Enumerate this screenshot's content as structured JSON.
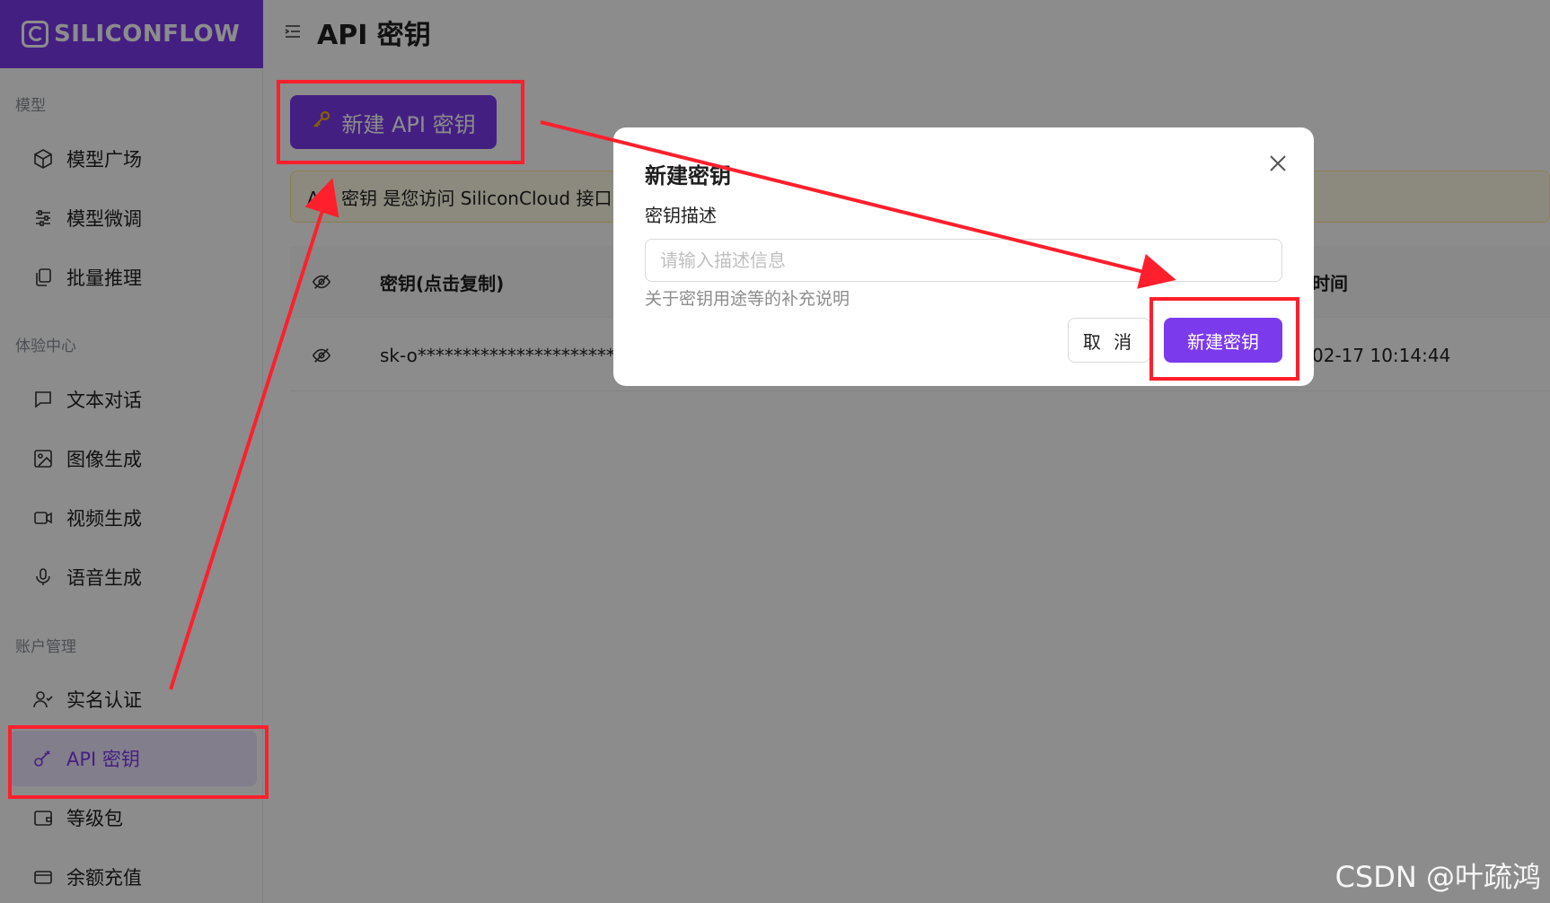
{
  "brand": {
    "name": "SILICONFLOW",
    "accent": "#7c3aed"
  },
  "sidebar": {
    "sections": [
      {
        "label": "模型",
        "items": [
          {
            "label": "模型广场",
            "icon": "cube-icon"
          },
          {
            "label": "模型微调",
            "icon": "sliders-icon"
          },
          {
            "label": "批量推理",
            "icon": "copy-icon"
          }
        ]
      },
      {
        "label": "体验中心",
        "items": [
          {
            "label": "文本对话",
            "icon": "chat-icon"
          },
          {
            "label": "图像生成",
            "icon": "image-icon"
          },
          {
            "label": "视频生成",
            "icon": "video-icon"
          },
          {
            "label": "语音生成",
            "icon": "mic-icon"
          }
        ]
      },
      {
        "label": "账户管理",
        "items": [
          {
            "label": "实名认证",
            "icon": "user-check-icon"
          },
          {
            "label": "API 密钥",
            "icon": "key-icon",
            "active": true
          },
          {
            "label": "等级包",
            "icon": "wallet-icon"
          },
          {
            "label": "余额充值",
            "icon": "card-icon"
          }
        ]
      }
    ]
  },
  "header": {
    "title": "API 密钥"
  },
  "main": {
    "new_key_button": "新建 API 密钥",
    "notice": "API 密钥 是您访问 SiliconCloud 接口的",
    "table": {
      "columns": [
        "密钥(点击复制)",
        "时间"
      ],
      "rows": [
        {
          "key": "sk-o*************************",
          "time": "02-17 10:14:44"
        }
      ]
    }
  },
  "modal": {
    "title": "新建密钥",
    "field_label": "密钥描述",
    "placeholder": "请输入描述信息",
    "value": "",
    "help": "关于密钥用途等的补充说明",
    "cancel": "取 消",
    "submit": "新建密钥"
  },
  "annotation_color": "#ff1f2d",
  "watermark": "CSDN @叶疏鸿"
}
